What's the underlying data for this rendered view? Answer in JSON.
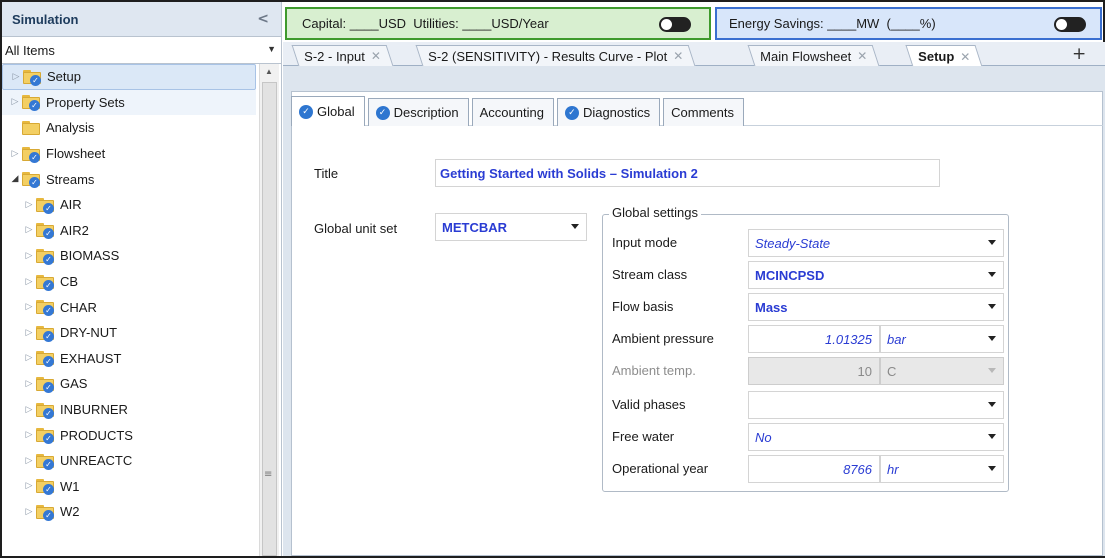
{
  "nav": {
    "title": "Simulation",
    "collapse_glyph": "<",
    "filter_value": "All Items",
    "items": [
      {
        "label": "Setup",
        "icon": "checked-folder-icon"
      },
      {
        "label": "Property Sets",
        "icon": "checked-folder-icon"
      },
      {
        "label": "Analysis",
        "icon": "folder-icon"
      },
      {
        "label": "Flowsheet",
        "icon": "checked-folder-icon"
      },
      {
        "label": "Streams",
        "icon": "checked-folder-icon"
      },
      {
        "label": "AIR",
        "icon": "checked-folder-icon"
      },
      {
        "label": "AIR2",
        "icon": "checked-folder-icon"
      },
      {
        "label": "BIOMASS",
        "icon": "checked-folder-icon"
      },
      {
        "label": "CB",
        "icon": "checked-folder-icon"
      },
      {
        "label": "CHAR",
        "icon": "checked-folder-icon"
      },
      {
        "label": "DRY-NUT",
        "icon": "checked-folder-icon"
      },
      {
        "label": "EXHAUST",
        "icon": "checked-folder-icon"
      },
      {
        "label": "GAS",
        "icon": "checked-folder-icon"
      },
      {
        "label": "INBURNER",
        "icon": "checked-folder-icon"
      },
      {
        "label": "PRODUCTS",
        "icon": "checked-folder-icon"
      },
      {
        "label": "UNREACTC",
        "icon": "checked-folder-icon"
      },
      {
        "label": "W1",
        "icon": "checked-folder-icon"
      },
      {
        "label": "W2",
        "icon": "checked-folder-icon"
      }
    ]
  },
  "cost_bar": {
    "capital_text": "Capital: ____USD  Utilities: ____USD/Year",
    "energy_text": "Energy Savings: ____MW  (____%)",
    "accent_green": "#3e9a2c",
    "accent_blue": "#3a6fd0"
  },
  "doc_tabs": [
    {
      "label": "S-2 - Input",
      "active": false
    },
    {
      "label": "S-2 (SENSITIVITY) - Results Curve - Plot",
      "active": false
    },
    {
      "label": "Main Flowsheet",
      "active": false
    },
    {
      "label": "Setup",
      "active": true
    }
  ],
  "form_tabs": [
    {
      "label": "Global",
      "checked": true
    },
    {
      "label": "Description",
      "checked": true
    },
    {
      "label": "Accounting",
      "checked": false
    },
    {
      "label": "Diagnostics",
      "checked": true
    },
    {
      "label": "Comments",
      "checked": false
    }
  ],
  "form": {
    "title_label": "Title",
    "title_value": "Getting Started with Solids – Simulation 2",
    "unit_set_label": "Global unit set",
    "unit_set_value": "METCBAR",
    "group_title": "Global settings",
    "input_mode_label": "Input mode",
    "input_mode_value": "Steady-State",
    "stream_class_label": "Stream class",
    "stream_class_value": "MCINCPSD",
    "flow_basis_label": "Flow basis",
    "flow_basis_value": "Mass",
    "ambient_pressure_label": "Ambient pressure",
    "ambient_pressure_value": "1.01325",
    "ambient_pressure_unit": "bar",
    "ambient_temp_label": "Ambient temp.",
    "ambient_temp_value": "10",
    "ambient_temp_unit": "C",
    "valid_phases_label": "Valid phases",
    "valid_phases_value": "",
    "free_water_label": "Free water",
    "free_water_value": "No",
    "operational_year_label": "Operational year",
    "operational_year_value": "8766",
    "operational_year_unit": "hr",
    "value_color": "#2a3cd3"
  }
}
